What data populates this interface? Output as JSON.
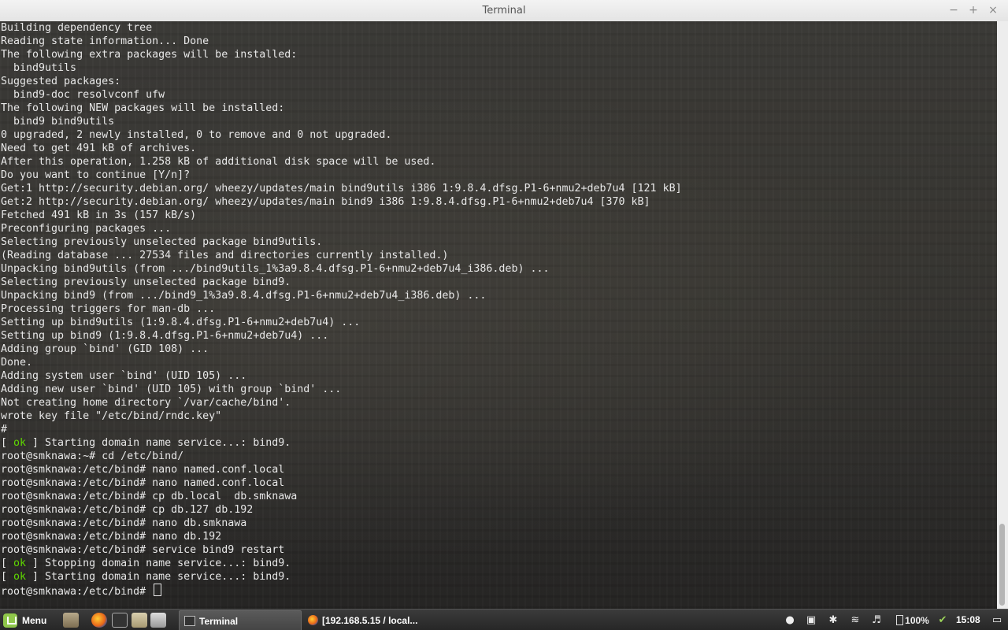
{
  "window": {
    "title": "Terminal",
    "minimize_glyph": "−",
    "maximize_glyph": "+",
    "close_glyph": "×"
  },
  "terminal": {
    "lines": [
      "Building dependency tree",
      "Reading state information... Done",
      "The following extra packages will be installed:",
      "  bind9utils",
      "Suggested packages:",
      "  bind9-doc resolvconf ufw",
      "The following NEW packages will be installed:",
      "  bind9 bind9utils",
      "0 upgraded, 2 newly installed, 0 to remove and 0 not upgraded.",
      "Need to get 491 kB of archives.",
      "After this operation, 1.258 kB of additional disk space will be used.",
      "Do you want to continue [Y/n]?",
      "Get:1 http://security.debian.org/ wheezy/updates/main bind9utils i386 1:9.8.4.dfsg.P1-6+nmu2+deb7u4 [121 kB]",
      "Get:2 http://security.debian.org/ wheezy/updates/main bind9 i386 1:9.8.4.dfsg.P1-6+nmu2+deb7u4 [370 kB]",
      "Fetched 491 kB in 3s (157 kB/s)",
      "Preconfiguring packages ...",
      "Selecting previously unselected package bind9utils.",
      "(Reading database ... 27534 files and directories currently installed.)",
      "Unpacking bind9utils (from .../bind9utils_1%3a9.8.4.dfsg.P1-6+nmu2+deb7u4_i386.deb) ...",
      "Selecting previously unselected package bind9.",
      "Unpacking bind9 (from .../bind9_1%3a9.8.4.dfsg.P1-6+nmu2+deb7u4_i386.deb) ...",
      "Processing triggers for man-db ...",
      "Setting up bind9utils (1:9.8.4.dfsg.P1-6+nmu2+deb7u4) ...",
      "Setting up bind9 (1:9.8.4.dfsg.P1-6+nmu2+deb7u4) ...",
      "Adding group `bind' (GID 108) ...",
      "Done.",
      "Adding system user `bind' (UID 105) ...",
      "Adding new user `bind' (UID 105) with group `bind' ...",
      "Not creating home directory `/var/cache/bind'.",
      "wrote key file \"/etc/bind/rndc.key\"",
      "#",
      "[ ok ] Starting domain name service...: bind9.",
      "root@smknawa:~# cd /etc/bind/",
      "root@smknawa:/etc/bind# nano named.conf.local",
      "root@smknawa:/etc/bind# nano named.conf.local",
      "root@smknawa:/etc/bind# cp db.local  db.smknawa",
      "root@smknawa:/etc/bind# cp db.127 db.192",
      "root@smknawa:/etc/bind# nano db.smknawa",
      "root@smknawa:/etc/bind# nano db.192",
      "root@smknawa:/etc/bind# service bind9 restart",
      "[ ok ] Stopping domain name service...: bind9.",
      "[ ok ] Starting domain name service...: bind9.",
      "root@smknawa:/etc/bind# "
    ],
    "ok_color": "#5fd700",
    "text_color": "#e8e8e8"
  },
  "taskbar": {
    "menu_label": "Menu",
    "launchers": [
      "file-cabinet-icon",
      "firefox-icon",
      "terminal-icon",
      "folder-icon",
      "printer-icon"
    ],
    "tasks": [
      {
        "label": "Terminal",
        "icon": "terminal-icon",
        "active": true
      },
      {
        "label": "[192.168.5.15 / local...",
        "icon": "firefox-icon",
        "active": false
      }
    ],
    "tray": {
      "battery": "100%",
      "clock": "15:08"
    }
  }
}
